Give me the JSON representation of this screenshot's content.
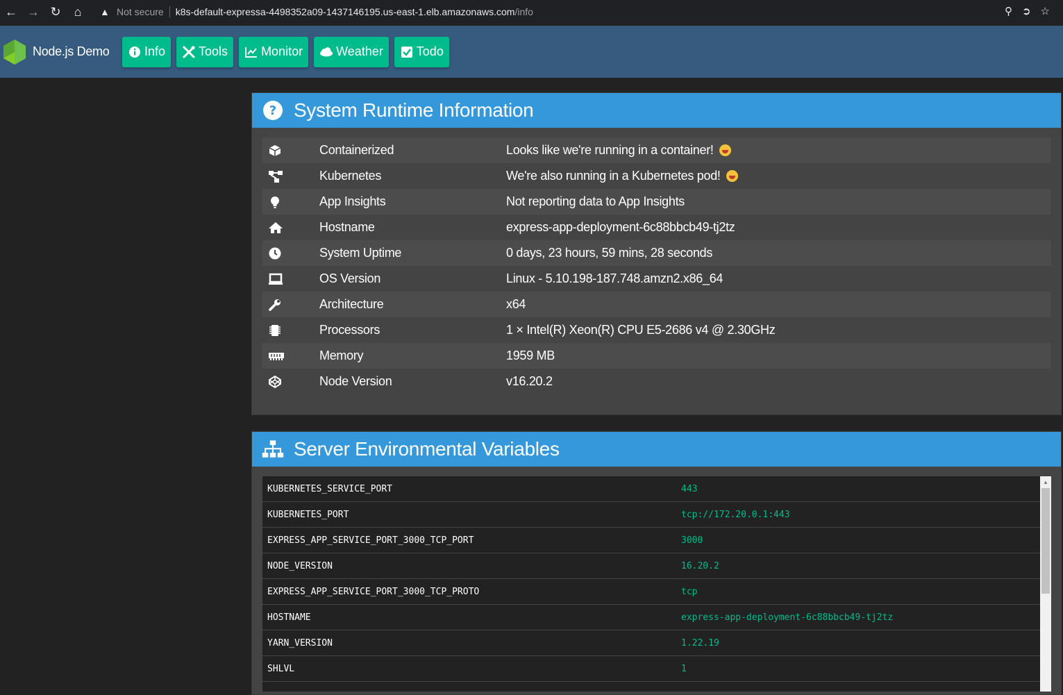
{
  "browser": {
    "security_label": "Not secure",
    "url_host": "k8s-default-expressa-4498352a09-1437146195.us-east-1.elb.amazonaws.com",
    "url_path": "/info"
  },
  "app": {
    "brand": "Node.js Demo",
    "nav": [
      {
        "label": "Info",
        "icon": "info-icon"
      },
      {
        "label": "Tools",
        "icon": "tools-icon"
      },
      {
        "label": "Monitor",
        "icon": "chart-line-icon"
      },
      {
        "label": "Weather",
        "icon": "cloud-icon"
      },
      {
        "label": "Todo",
        "icon": "checkbox-icon"
      }
    ]
  },
  "runtime": {
    "title": "System Runtime Information",
    "rows": [
      {
        "icon": "cube-icon",
        "label": "Containerized",
        "value": "Looks like we're running in a container!",
        "emoji": true
      },
      {
        "icon": "network-icon",
        "label": "Kubernetes",
        "value": "We're also running in a Kubernetes pod!",
        "emoji": true
      },
      {
        "icon": "lightbulb-icon",
        "label": "App Insights",
        "value": "Not reporting data to App Insights",
        "emoji": false
      },
      {
        "icon": "home-icon",
        "label": "Hostname",
        "value": "express-app-deployment-6c88bbcb49-tj2tz",
        "emoji": false
      },
      {
        "icon": "clock-icon",
        "label": "System Uptime",
        "value": "0 days, 23 hours, 59 mins, 28 seconds",
        "emoji": false
      },
      {
        "icon": "laptop-icon",
        "label": "OS Version",
        "value": "Linux - 5.10.198-187.748.amzn2.x86_64",
        "emoji": false
      },
      {
        "icon": "wrench-icon",
        "label": "Architecture",
        "value": "x64",
        "emoji": false
      },
      {
        "icon": "microchip-icon",
        "label": "Processors",
        "value": "1 × Intel(R) Xeon(R) CPU E5-2686 v4 @ 2.30GHz",
        "emoji": false
      },
      {
        "icon": "memory-icon",
        "label": "Memory",
        "value": "1959 MB",
        "emoji": false
      },
      {
        "icon": "codepen-icon",
        "label": "Node Version",
        "value": "v16.20.2",
        "emoji": false
      }
    ]
  },
  "env": {
    "title": "Server Environmental Variables",
    "rows": [
      {
        "key": "KUBERNETES_SERVICE_PORT",
        "value": "443"
      },
      {
        "key": "KUBERNETES_PORT",
        "value": "tcp://172.20.0.1:443"
      },
      {
        "key": "EXPRESS_APP_SERVICE_PORT_3000_TCP_PORT",
        "value": "3000"
      },
      {
        "key": "NODE_VERSION",
        "value": "16.20.2"
      },
      {
        "key": "EXPRESS_APP_SERVICE_PORT_3000_TCP_PROTO",
        "value": "tcp"
      },
      {
        "key": "HOSTNAME",
        "value": "express-app-deployment-6c88bbcb49-tj2tz"
      },
      {
        "key": "YARN_VERSION",
        "value": "1.22.19"
      },
      {
        "key": "SHLVL",
        "value": "1"
      }
    ]
  },
  "colors": {
    "navbar": "#375a7f",
    "accent": "#00bc8c",
    "header": "#3498db",
    "background": "#222222"
  }
}
